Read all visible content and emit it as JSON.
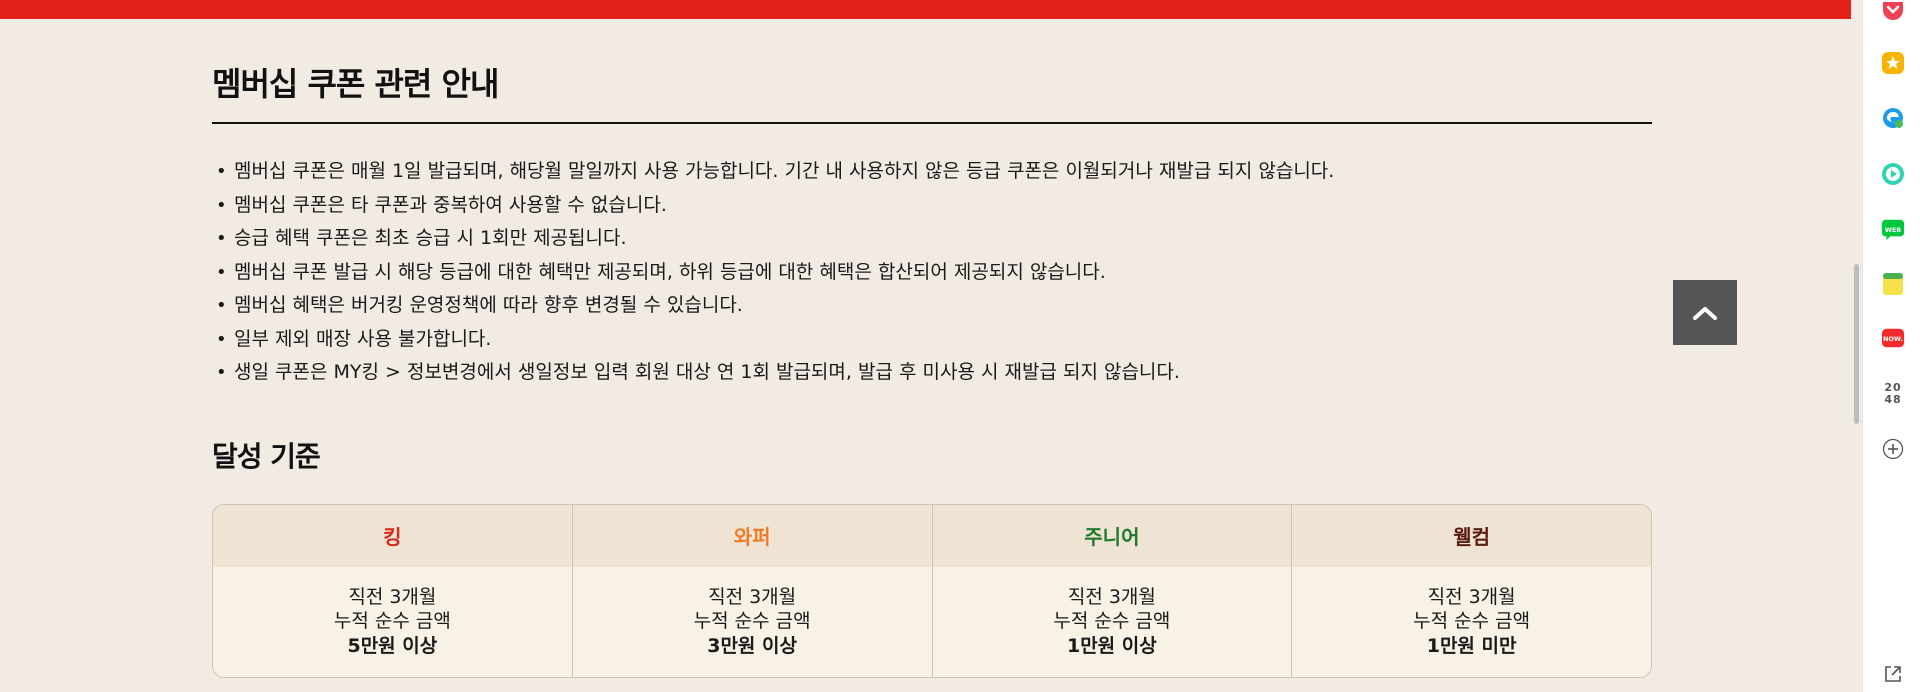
{
  "notice": {
    "title": "멤버십 쿠폰 관련 안내",
    "items": [
      "멤버십 쿠폰은 매월 1일 발급되며, 해당월 말일까지 사용 가능합니다. 기간 내 사용하지 않은 등급 쿠폰은 이월되거나 재발급 되지 않습니다.",
      "멤버십 쿠폰은 타 쿠폰과 중복하여 사용할 수 없습니다.",
      "승급 혜택 쿠폰은 최초 승급 시 1회만 제공됩니다.",
      "멤버십 쿠폰 발급 시 해당 등급에 대한 혜택만 제공되며, 하위 등급에 대한 혜택은 합산되어 제공되지 않습니다.",
      "멤버십 혜택은 버거킹 운영정책에 따라 향후 변경될 수 있습니다.",
      "일부 제외 매장 사용 불가합니다.",
      "생일 쿠폰은 MY킹 > 정보변경에서 생일정보 입력 회원 대상 연 1회 발급되며, 발급 후 미사용 시 재발급 되지 않습니다."
    ]
  },
  "criteria": {
    "title": "달성 기준",
    "grades": [
      {
        "name": "킹",
        "color": "#d6281c",
        "line1": "직전 3개월",
        "line2": "누적 순수 금액",
        "line3": "5만원 이상"
      },
      {
        "name": "와퍼",
        "color": "#f07c2a",
        "line1": "직전 3개월",
        "line2": "누적 순수 금액",
        "line3": "3만원 이상"
      },
      {
        "name": "주니어",
        "color": "#1f7a2e",
        "line1": "직전 3개월",
        "line2": "누적 순수 금액",
        "line3": "1만원 이상"
      },
      {
        "name": "웰컴",
        "color": "#5a1e10",
        "line1": "직전 3개월",
        "line2": "누적 순수 금액",
        "line3": "1만원 미만"
      }
    ]
  },
  "sidebar": {
    "text_2048_top": "20",
    "text_2048_bottom": "48",
    "icons": [
      "pocket-icon",
      "star-icon",
      "edge-icon",
      "media-player-icon",
      "webtoon-icon",
      "notes-icon",
      "now-icon",
      "2048-game-icon",
      "add-icon",
      "external-link-icon"
    ]
  },
  "colors": {
    "brand_red": "#e3211b",
    "background": "#f2ebe4",
    "table_header": "#efe4d4",
    "table_body": "#f8f1e6"
  }
}
